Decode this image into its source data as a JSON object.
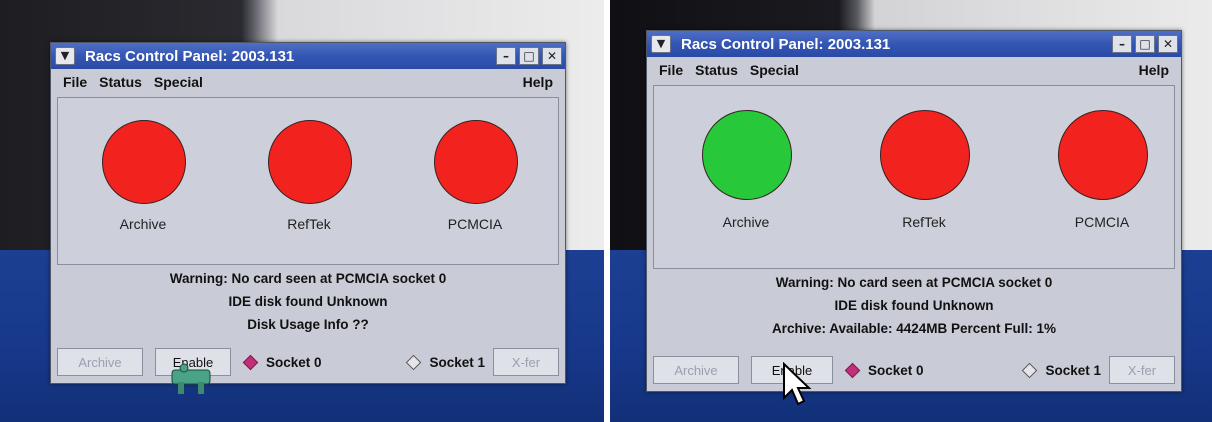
{
  "panels": [
    {
      "window": {
        "title": "Racs Control Panel: 2003.131"
      },
      "menu": [
        "File",
        "Status",
        "Special"
      ],
      "help": "Help",
      "indicators": [
        {
          "label": "Archive",
          "color": "#f2231e"
        },
        {
          "label": "RefTek",
          "color": "#f2231e"
        },
        {
          "label": "PCMCIA",
          "color": "#f2231e"
        }
      ],
      "messages": [
        "Warning: No card seen at PCMCIA socket 0",
        "IDE disk found Unknown",
        "Disk Usage Info ??"
      ],
      "buttons": {
        "archive": "Archive",
        "enable": "Enable",
        "socket0": "Socket 0",
        "socket1": "Socket 1",
        "xfer": "X-fer"
      }
    },
    {
      "window": {
        "title": "Racs Control Panel: 2003.131"
      },
      "menu": [
        "File",
        "Status",
        "Special"
      ],
      "help": "Help",
      "indicators": [
        {
          "label": "Archive",
          "color": "#27c93a"
        },
        {
          "label": "RefTek",
          "color": "#f2231e"
        },
        {
          "label": "PCMCIA",
          "color": "#f2231e"
        }
      ],
      "messages": [
        "Warning: No card seen at PCMCIA socket 0",
        "IDE disk found Unknown",
        "Archive:  Available: 4424MB Percent Full: 1%"
      ],
      "buttons": {
        "archive": "Archive",
        "enable": "Enable",
        "socket0": "Socket 0",
        "socket1": "Socket 1",
        "xfer": "X-fer"
      }
    }
  ],
  "colors": {
    "titlebar": "#3456b4",
    "window_bg": "#c9ccd6",
    "radio_selected": "#c0307a",
    "desktop": "#1d3f93"
  }
}
